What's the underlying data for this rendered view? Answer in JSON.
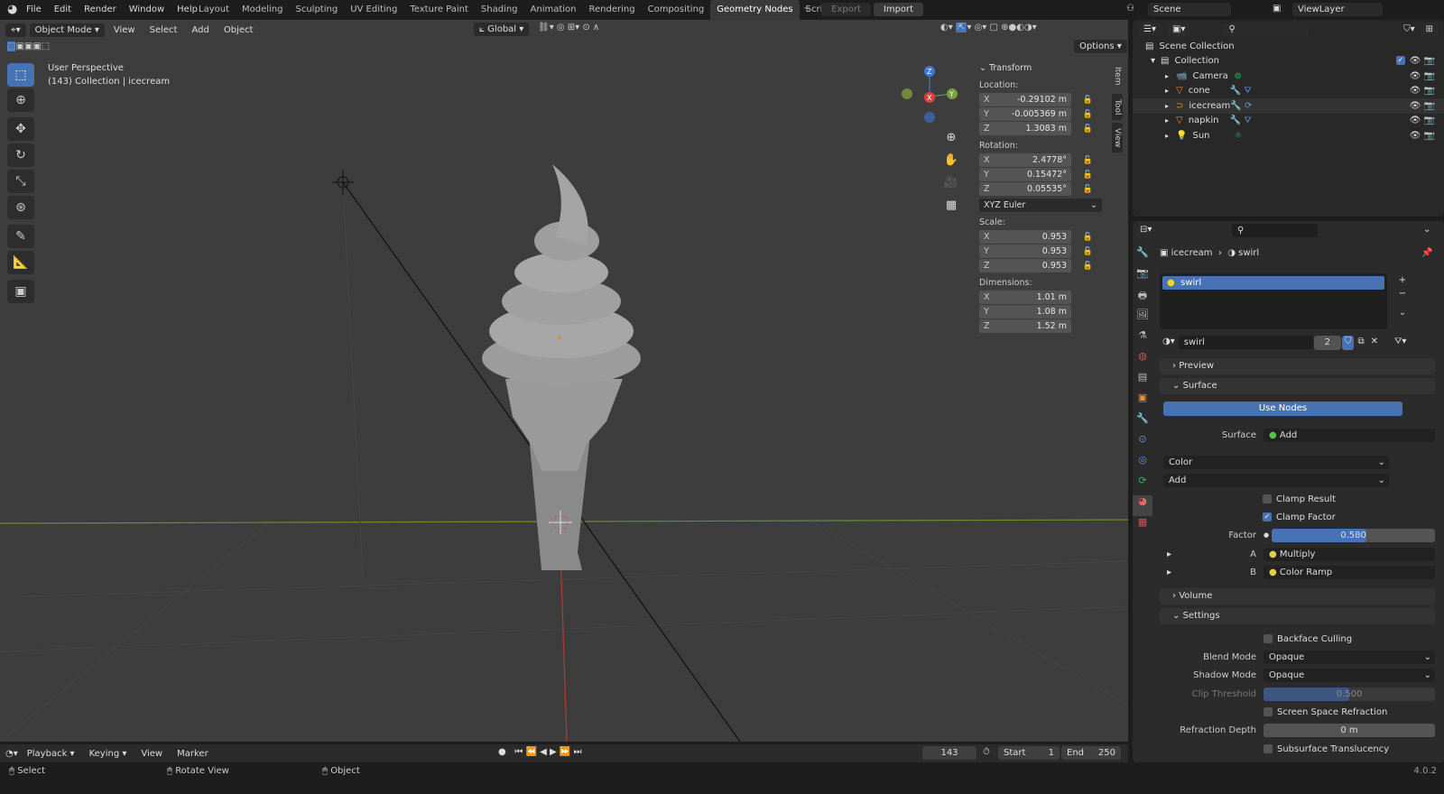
{
  "app_menu": [
    "File",
    "Edit",
    "Render",
    "Window",
    "Help"
  ],
  "workspaces": [
    "Layout",
    "Modeling",
    "Sculpting",
    "UV Editing",
    "Texture Paint",
    "Shading",
    "Animation",
    "Rendering",
    "Compositing",
    "Geometry Nodes",
    "Scripting"
  ],
  "active_workspace": "Geometry Nodes",
  "topbar": {
    "export": "Export",
    "import": "Import",
    "scene": "Scene",
    "view_layer": "ViewLayer"
  },
  "viewport": {
    "mode": "Object Mode",
    "menus": [
      "View",
      "Select",
      "Add",
      "Object"
    ],
    "orientation": "Global",
    "options": "Options",
    "overlay_title": "User Perspective",
    "overlay_subtitle": "(143) Collection | icecream",
    "gizmo": {
      "x": "X",
      "y": "Y",
      "z": "Z"
    }
  },
  "transform": {
    "title": "Transform",
    "location_label": "Location:",
    "location": [
      [
        "X",
        "-0.29102 m"
      ],
      [
        "Y",
        "-0.005369 m"
      ],
      [
        "Z",
        "1.3083 m"
      ]
    ],
    "rotation_label": "Rotation:",
    "rotation": [
      [
        "X",
        "2.4778°"
      ],
      [
        "Y",
        "0.15472°"
      ],
      [
        "Z",
        "0.05535°"
      ]
    ],
    "rotation_mode": "XYZ Euler",
    "scale_label": "Scale:",
    "scale": [
      [
        "X",
        "0.953"
      ],
      [
        "Y",
        "0.953"
      ],
      [
        "Z",
        "0.953"
      ]
    ],
    "dimensions_label": "Dimensions:",
    "dimensions": [
      [
        "X",
        "1.01 m"
      ],
      [
        "Y",
        "1.08 m"
      ],
      [
        "Z",
        "1.52 m"
      ]
    ]
  },
  "side_tabs": [
    "Item",
    "Tool",
    "View"
  ],
  "outliner": {
    "root": "Scene Collection",
    "collection": "Collection",
    "objects": [
      "Camera",
      "cone",
      "icecream",
      "napkin",
      "Sun"
    ]
  },
  "properties": {
    "breadcrumb_object": "icecream",
    "breadcrumb_material": "swirl",
    "slot": "swirl",
    "material_name": "swirl",
    "users": "2",
    "sections": {
      "preview": "Preview",
      "surface": "Surface",
      "volume": "Volume",
      "settings": "Settings"
    },
    "use_nodes": "Use Nodes",
    "surface_label": "Surface",
    "surface_value": "Add",
    "color_dropdown": "Color",
    "add_dropdown": "Add",
    "clamp_result": "Clamp Result",
    "clamp_factor": "Clamp Factor",
    "factor_label": "Factor",
    "factor_value": "0.580",
    "factor": 0.58,
    "a_label": "A",
    "a_value": "Multiply",
    "b_label": "B",
    "b_value": "Color Ramp",
    "backface": "Backface Culling",
    "blend_label": "Blend Mode",
    "blend_value": "Opaque",
    "shadow_label": "Shadow Mode",
    "shadow_value": "Opaque",
    "clip_label": "Clip Threshold",
    "clip_value": "0.500",
    "clip": 0.5,
    "ssr": "Screen Space Refraction",
    "refr_label": "Refraction Depth",
    "refr_value": "0 m",
    "sss": "Subsurface Translucency"
  },
  "timeline": {
    "menus": [
      "Playback",
      "Keying",
      "View",
      "Marker"
    ],
    "current_frame": "143",
    "start_label": "Start",
    "start": "1",
    "end_label": "End",
    "end": "250"
  },
  "status": {
    "select": "Select",
    "rotate": "Rotate View",
    "object": "Object",
    "version": "4.0.2"
  },
  "colors": {
    "accent": "#4772b3",
    "viewport_bg": "#3d3d3d"
  }
}
